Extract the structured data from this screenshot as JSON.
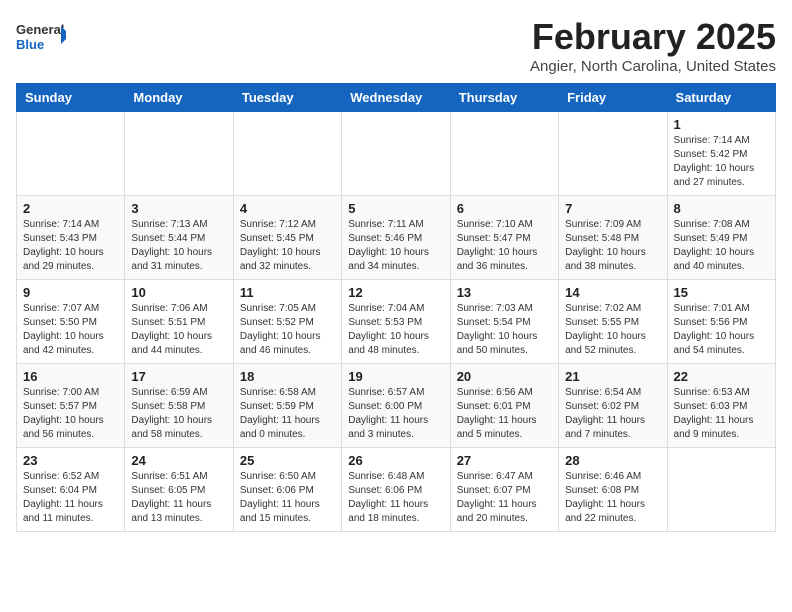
{
  "header": {
    "logo_general": "General",
    "logo_blue": "Blue",
    "month_title": "February 2025",
    "location": "Angier, North Carolina, United States"
  },
  "weekdays": [
    "Sunday",
    "Monday",
    "Tuesday",
    "Wednesday",
    "Thursday",
    "Friday",
    "Saturday"
  ],
  "weeks": [
    [
      {
        "day": "",
        "info": ""
      },
      {
        "day": "",
        "info": ""
      },
      {
        "day": "",
        "info": ""
      },
      {
        "day": "",
        "info": ""
      },
      {
        "day": "",
        "info": ""
      },
      {
        "day": "",
        "info": ""
      },
      {
        "day": "1",
        "info": "Sunrise: 7:14 AM\nSunset: 5:42 PM\nDaylight: 10 hours\nand 27 minutes."
      }
    ],
    [
      {
        "day": "2",
        "info": "Sunrise: 7:14 AM\nSunset: 5:43 PM\nDaylight: 10 hours\nand 29 minutes."
      },
      {
        "day": "3",
        "info": "Sunrise: 7:13 AM\nSunset: 5:44 PM\nDaylight: 10 hours\nand 31 minutes."
      },
      {
        "day": "4",
        "info": "Sunrise: 7:12 AM\nSunset: 5:45 PM\nDaylight: 10 hours\nand 32 minutes."
      },
      {
        "day": "5",
        "info": "Sunrise: 7:11 AM\nSunset: 5:46 PM\nDaylight: 10 hours\nand 34 minutes."
      },
      {
        "day": "6",
        "info": "Sunrise: 7:10 AM\nSunset: 5:47 PM\nDaylight: 10 hours\nand 36 minutes."
      },
      {
        "day": "7",
        "info": "Sunrise: 7:09 AM\nSunset: 5:48 PM\nDaylight: 10 hours\nand 38 minutes."
      },
      {
        "day": "8",
        "info": "Sunrise: 7:08 AM\nSunset: 5:49 PM\nDaylight: 10 hours\nand 40 minutes."
      }
    ],
    [
      {
        "day": "9",
        "info": "Sunrise: 7:07 AM\nSunset: 5:50 PM\nDaylight: 10 hours\nand 42 minutes."
      },
      {
        "day": "10",
        "info": "Sunrise: 7:06 AM\nSunset: 5:51 PM\nDaylight: 10 hours\nand 44 minutes."
      },
      {
        "day": "11",
        "info": "Sunrise: 7:05 AM\nSunset: 5:52 PM\nDaylight: 10 hours\nand 46 minutes."
      },
      {
        "day": "12",
        "info": "Sunrise: 7:04 AM\nSunset: 5:53 PM\nDaylight: 10 hours\nand 48 minutes."
      },
      {
        "day": "13",
        "info": "Sunrise: 7:03 AM\nSunset: 5:54 PM\nDaylight: 10 hours\nand 50 minutes."
      },
      {
        "day": "14",
        "info": "Sunrise: 7:02 AM\nSunset: 5:55 PM\nDaylight: 10 hours\nand 52 minutes."
      },
      {
        "day": "15",
        "info": "Sunrise: 7:01 AM\nSunset: 5:56 PM\nDaylight: 10 hours\nand 54 minutes."
      }
    ],
    [
      {
        "day": "16",
        "info": "Sunrise: 7:00 AM\nSunset: 5:57 PM\nDaylight: 10 hours\nand 56 minutes."
      },
      {
        "day": "17",
        "info": "Sunrise: 6:59 AM\nSunset: 5:58 PM\nDaylight: 10 hours\nand 58 minutes."
      },
      {
        "day": "18",
        "info": "Sunrise: 6:58 AM\nSunset: 5:59 PM\nDaylight: 11 hours\nand 0 minutes."
      },
      {
        "day": "19",
        "info": "Sunrise: 6:57 AM\nSunset: 6:00 PM\nDaylight: 11 hours\nand 3 minutes."
      },
      {
        "day": "20",
        "info": "Sunrise: 6:56 AM\nSunset: 6:01 PM\nDaylight: 11 hours\nand 5 minutes."
      },
      {
        "day": "21",
        "info": "Sunrise: 6:54 AM\nSunset: 6:02 PM\nDaylight: 11 hours\nand 7 minutes."
      },
      {
        "day": "22",
        "info": "Sunrise: 6:53 AM\nSunset: 6:03 PM\nDaylight: 11 hours\nand 9 minutes."
      }
    ],
    [
      {
        "day": "23",
        "info": "Sunrise: 6:52 AM\nSunset: 6:04 PM\nDaylight: 11 hours\nand 11 minutes."
      },
      {
        "day": "24",
        "info": "Sunrise: 6:51 AM\nSunset: 6:05 PM\nDaylight: 11 hours\nand 13 minutes."
      },
      {
        "day": "25",
        "info": "Sunrise: 6:50 AM\nSunset: 6:06 PM\nDaylight: 11 hours\nand 15 minutes."
      },
      {
        "day": "26",
        "info": "Sunrise: 6:48 AM\nSunset: 6:06 PM\nDaylight: 11 hours\nand 18 minutes."
      },
      {
        "day": "27",
        "info": "Sunrise: 6:47 AM\nSunset: 6:07 PM\nDaylight: 11 hours\nand 20 minutes."
      },
      {
        "day": "28",
        "info": "Sunrise: 6:46 AM\nSunset: 6:08 PM\nDaylight: 11 hours\nand 22 minutes."
      },
      {
        "day": "",
        "info": ""
      }
    ]
  ]
}
